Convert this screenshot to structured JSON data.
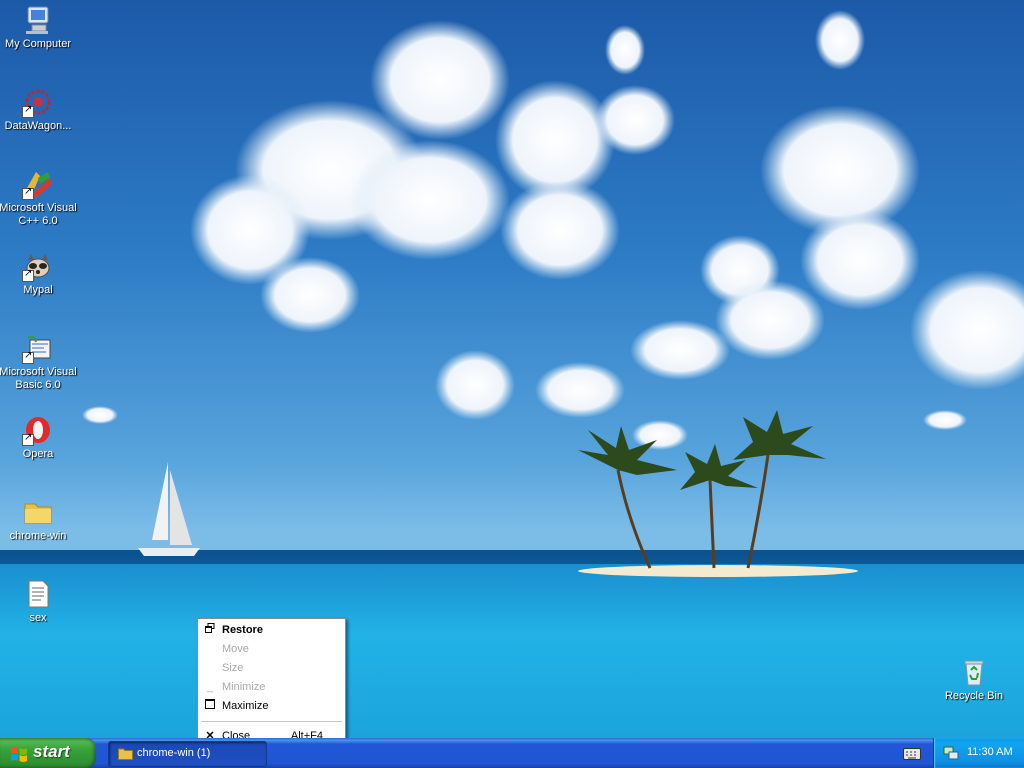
{
  "desktop": {
    "icons": [
      {
        "label": "My Computer",
        "icon": "my-computer-icon"
      },
      {
        "label": "DataWagon...",
        "icon": "datawagon-icon"
      },
      {
        "label": "Microsoft Visual\nC++ 6.0",
        "icon": "visual-cpp-icon"
      },
      {
        "label": "Mypal",
        "icon": "mypal-icon"
      },
      {
        "label": "Microsoft Visual\nBasic 6.0",
        "icon": "visual-basic-icon"
      },
      {
        "label": "Opera",
        "icon": "opera-icon"
      },
      {
        "label": "chrome-win",
        "icon": "folder-icon"
      },
      {
        "label": "sex",
        "icon": "text-file-icon"
      },
      {
        "label": "Recycle Bin",
        "icon": "recycle-bin-icon"
      }
    ]
  },
  "context_menu": {
    "items": [
      {
        "label": "Restore",
        "icon": "restore-icon",
        "state": "default"
      },
      {
        "label": "Move",
        "state": "disabled"
      },
      {
        "label": "Size",
        "state": "disabled"
      },
      {
        "label": "Minimize",
        "icon": "minimize-icon",
        "state": "disabled"
      },
      {
        "label": "Maximize",
        "icon": "maximize-icon",
        "state": "enabled"
      },
      {
        "label": "Close",
        "icon": "close-icon",
        "shortcut": "Alt+F4",
        "state": "enabled"
      }
    ]
  },
  "taskbar": {
    "start_label": "start",
    "task_label": "chrome-win (1)",
    "clock": "11:30 AM"
  },
  "colors": {
    "taskbar_blue": "#2157d7",
    "start_green": "#37a13a",
    "tray_blue": "#0f8fe3",
    "disabled_text": "#a9a9a9"
  }
}
